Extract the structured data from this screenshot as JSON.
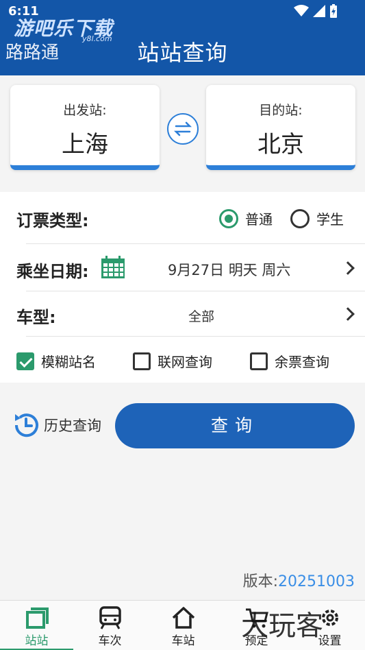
{
  "status_bar": {
    "time": "6:11"
  },
  "watermark": {
    "brand": "游吧乐下载",
    "url": "y8l.com",
    "corner": "大玩客"
  },
  "header": {
    "app_name": "路路通",
    "title": "站站查询"
  },
  "stations": {
    "from_label": "出发站:",
    "from_value": "上海",
    "to_label": "目的站:",
    "to_value": "北京"
  },
  "ticket_type": {
    "label": "订票类型:",
    "options": [
      {
        "label": "普通",
        "selected": true
      },
      {
        "label": "学生",
        "selected": false
      }
    ]
  },
  "date": {
    "label": "乘坐日期:",
    "value": "9月27日 明天 周六"
  },
  "train_type": {
    "label": "车型:",
    "value": "全部"
  },
  "options": [
    {
      "label": "模糊站名",
      "checked": true
    },
    {
      "label": "联网查询",
      "checked": false
    },
    {
      "label": "余票查询",
      "checked": false
    }
  ],
  "actions": {
    "history_label": "历史查询",
    "query_label": "查询"
  },
  "version": {
    "label": "版本:",
    "value": "20251003"
  },
  "nav": [
    {
      "label": "站站",
      "icon": "station-icon",
      "active": true
    },
    {
      "label": "车次",
      "icon": "train-icon",
      "active": false
    },
    {
      "label": "车站",
      "icon": "home-icon",
      "active": false
    },
    {
      "label": "预定",
      "icon": "cart-icon",
      "active": false
    },
    {
      "label": "设置",
      "icon": "gear-icon",
      "active": false
    }
  ],
  "colors": {
    "primary": "#1356a8",
    "accent": "#2d7fd8",
    "green": "#2b9a6c"
  }
}
